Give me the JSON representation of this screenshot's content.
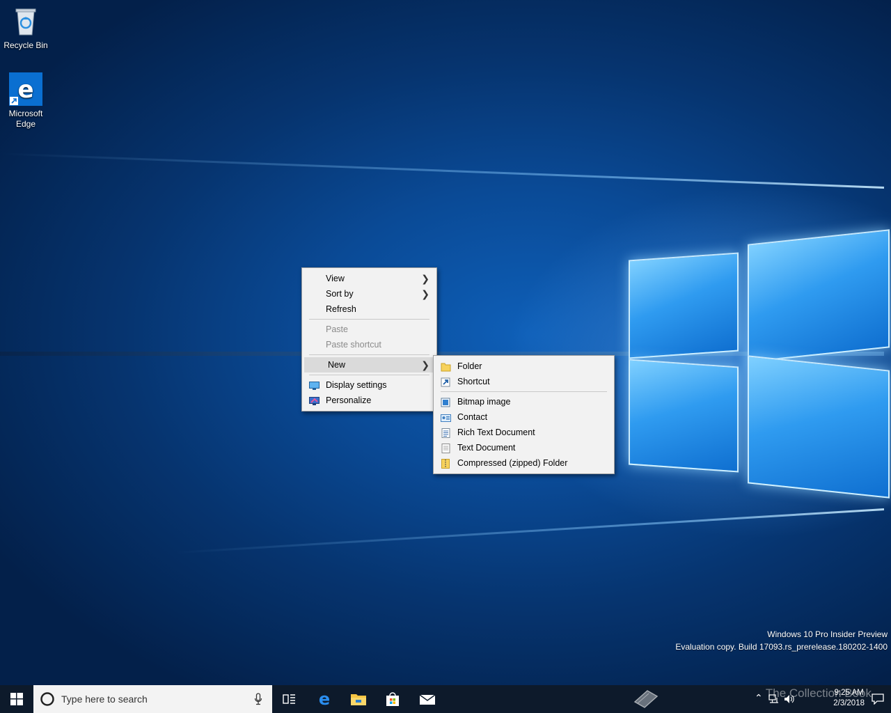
{
  "desktop": {
    "icons": [
      {
        "label": "Recycle Bin"
      },
      {
        "label": "Microsoft Edge"
      }
    ],
    "watermark": {
      "line1": "Windows 10 Pro Insider Preview",
      "line2": "Evaluation copy. Build 17093.rs_prerelease.180202-1400"
    }
  },
  "context_menu": {
    "items": [
      {
        "label": "View",
        "has_submenu": true
      },
      {
        "label": "Sort by",
        "has_submenu": true
      },
      {
        "label": "Refresh"
      },
      {
        "label": "Paste",
        "disabled": true
      },
      {
        "label": "Paste shortcut",
        "disabled": true
      },
      {
        "label": "New",
        "has_submenu": true,
        "highlighted": true
      },
      {
        "label": "Display settings",
        "icon": "display-settings-icon"
      },
      {
        "label": "Personalize",
        "icon": "personalize-icon"
      }
    ]
  },
  "new_submenu": {
    "items": [
      {
        "label": "Folder",
        "icon": "folder-icon"
      },
      {
        "label": "Shortcut",
        "icon": "shortcut-icon"
      },
      {
        "label": "Bitmap image",
        "icon": "bitmap-icon"
      },
      {
        "label": "Contact",
        "icon": "contact-icon"
      },
      {
        "label": "Rich Text Document",
        "icon": "rich-text-icon"
      },
      {
        "label": "Text Document",
        "icon": "text-document-icon"
      },
      {
        "label": "Compressed (zipped) Folder",
        "icon": "zip-folder-icon"
      }
    ]
  },
  "taskbar": {
    "search_placeholder": "Type here to search",
    "pinned": [
      "task-view-icon",
      "edge-icon",
      "file-explorer-icon",
      "store-icon",
      "mail-icon"
    ],
    "clock_time": "9:25 AM",
    "clock_date": "2/3/2018",
    "overlay_text": "The Collection Book",
    "accent": "#0078d7"
  }
}
